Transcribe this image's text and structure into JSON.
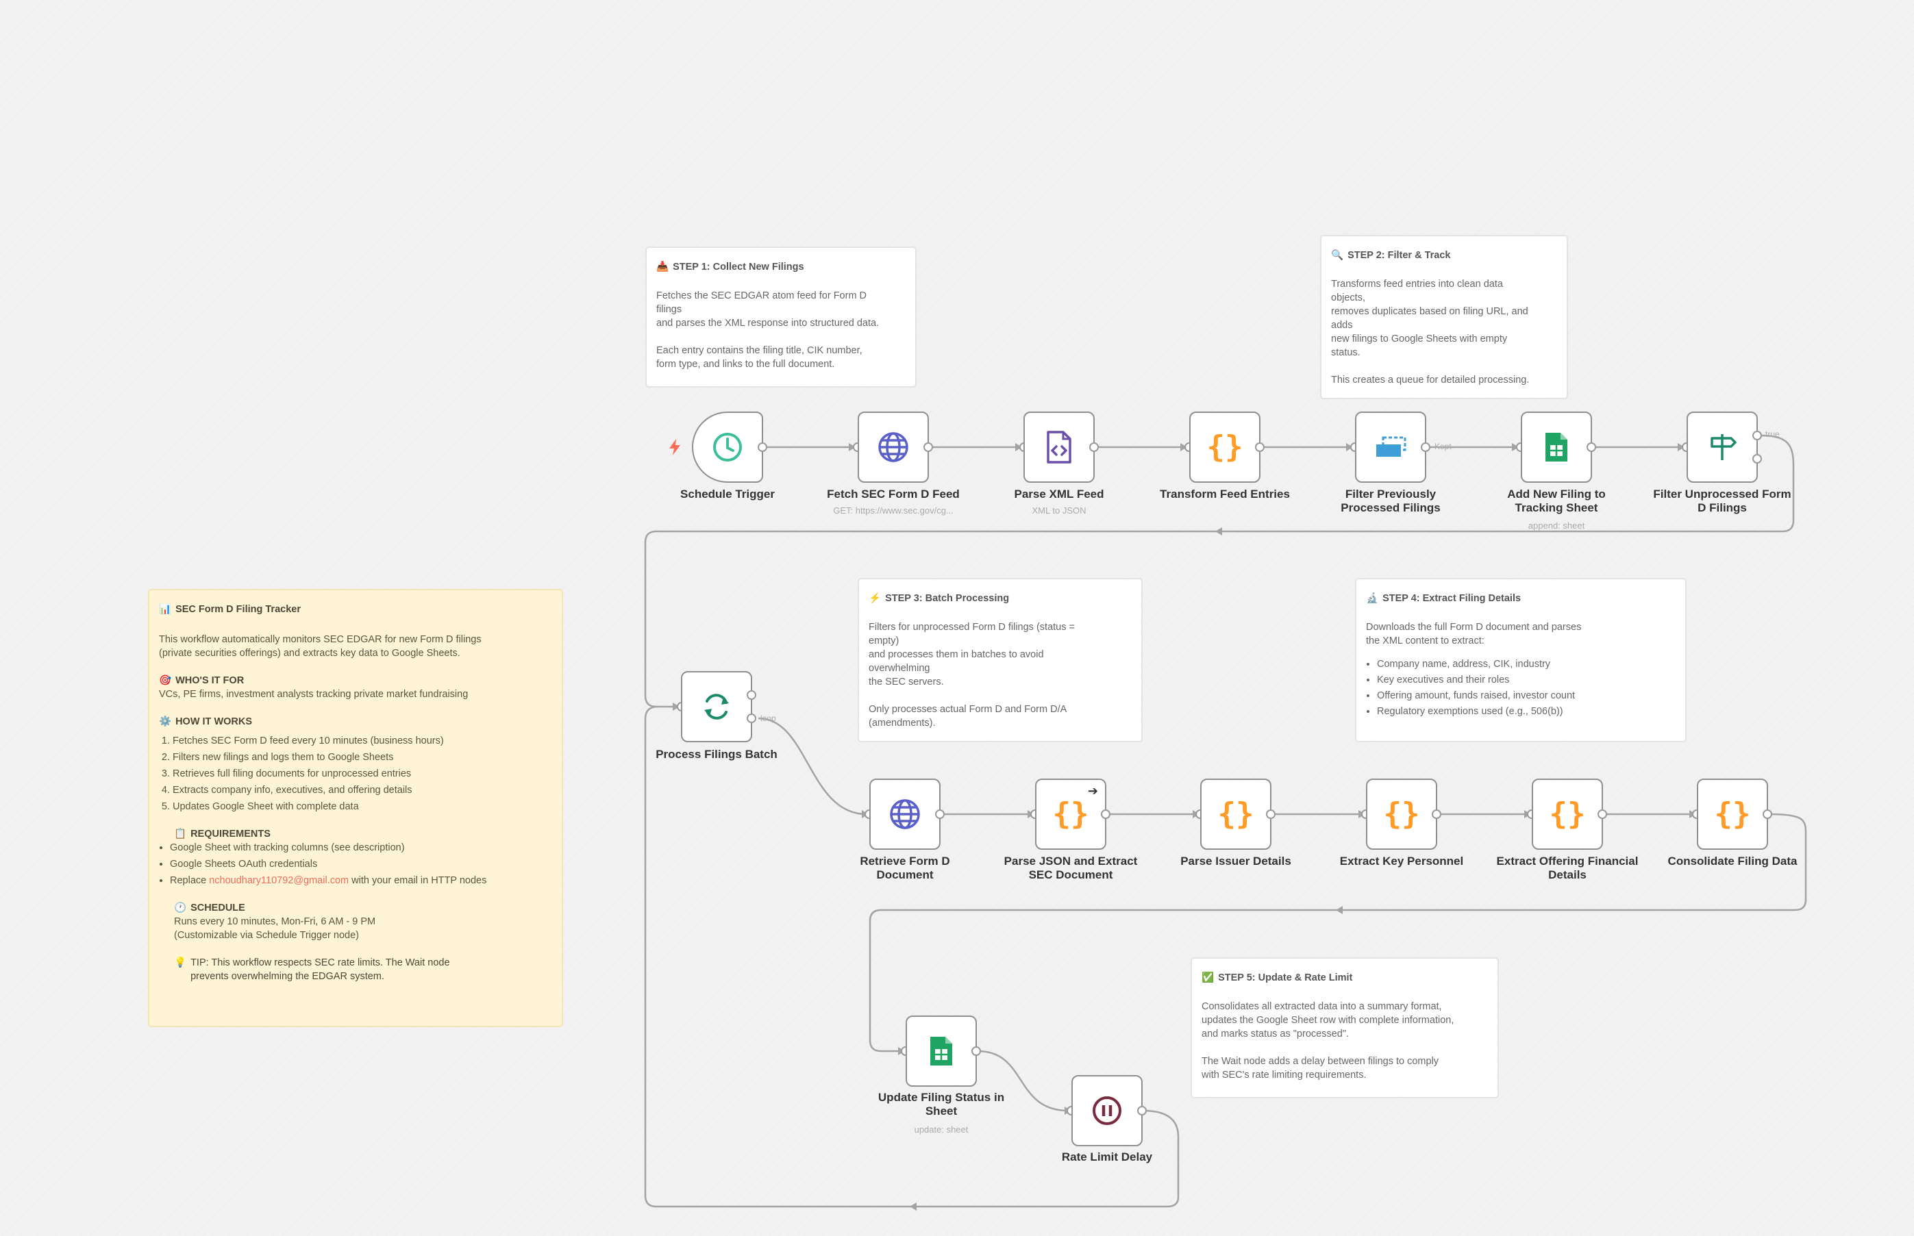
{
  "colors": {
    "accent_orange": "#ff9b26",
    "globe_blue": "#5a5fc9",
    "xml_purple": "#6b4fa8",
    "sheets_green": "#1fa463",
    "filter_blue": "#3d9ed8",
    "clock_teal": "#3bbf9a",
    "pause_maroon": "#7a2a3f",
    "trigger_red": "#ff6d5a",
    "sticky_yellow": "#fff5d6"
  },
  "overview": {
    "title": "SEC Form D Filing Tracker",
    "title_icon": "bar-chart-emoji",
    "intro": "This workflow automatically monitors SEC EDGAR for new Form D filings\n(private securities offerings) and extracts key data to Google Sheets.",
    "who_heading": "WHO'S IT FOR",
    "who_icon": "target-emoji",
    "who_text": "VCs, PE firms, investment analysts tracking private market fundraising",
    "how_heading": "HOW IT WORKS",
    "how_icon": "gear-emoji",
    "how_steps": [
      "Fetches SEC Form D feed every 10 minutes (business hours)",
      "Filters new filings and logs them to Google Sheets",
      "Retrieves full filing documents for unprocessed entries",
      "Extracts company info, executives, and offering details",
      "Updates Google Sheet with complete data"
    ],
    "req_heading": "REQUIREMENTS",
    "req_icon": "clipboard-emoji",
    "req_1": "Google Sheet with tracking columns (see description)",
    "req_2": "Google Sheets OAuth credentials",
    "req_3_prefix": "Replace ",
    "req_3_email": "nchoudhary110792@gmail.com",
    "req_3_suffix": " with your email in HTTP nodes",
    "schedule_heading": "SCHEDULE",
    "schedule_icon": "clock-emoji",
    "schedule_text": "Runs every 10 minutes, Mon-Fri, 6 AM - 9 PM\n(Customizable via Schedule Trigger node)",
    "tip_icon": "lightbulb-emoji",
    "tip_text": "TIP: This workflow respects SEC rate limits. The Wait node\nprevents overwhelming the EDGAR system."
  },
  "steps": [
    {
      "title": "STEP 1: Collect New Filings",
      "icon": "inbox-emoji",
      "body": "Fetches the SEC EDGAR atom feed for Form D\nfilings\nand parses the XML response into structured data.\n\nEach entry contains the filing title, CIK number,\nform type, and links to the full document."
    },
    {
      "title": "STEP 2: Filter & Track",
      "icon": "magnifier-emoji",
      "body": "Transforms feed entries into clean data\nobjects,\nremoves duplicates based on filing URL, and\nadds\nnew filings to Google Sheets with empty\nstatus.\n\nThis creates a queue for detailed processing."
    },
    {
      "title": "STEP 3: Batch Processing",
      "icon": "lightning-emoji",
      "body": "Filters for unprocessed Form D filings (status =\nempty)\nand processes them in batches to avoid\noverwhelming\nthe SEC servers.\n\nOnly processes actual Form D and Form D/A\n(amendments)."
    },
    {
      "title": "STEP 4: Extract Filing Details",
      "icon": "microscope-emoji",
      "intro": "Downloads the full Form D document and parses\nthe XML content to extract:",
      "bullets": [
        "Company name, address, CIK, industry",
        "Key executives and their roles",
        "Offering amount, funds raised, investor count",
        "Regulatory exemptions used (e.g., 506(b))"
      ]
    },
    {
      "title": "STEP 5: Update & Rate Limit",
      "icon": "check-mark-emoji",
      "body": "Consolidates all extracted data into a summary format,\nupdates the Google Sheet row with complete information,\nand marks status as \"processed\".\n\nThe Wait node adds a delay between filings to comply\nwith SEC's rate limiting requirements."
    }
  ],
  "nodes": [
    {
      "label": "Schedule Trigger",
      "sub": "",
      "icon": "clock-icon"
    },
    {
      "label": "Fetch SEC Form D Feed",
      "sub": "GET: https://www.sec.gov/cg...",
      "icon": "globe-icon"
    },
    {
      "label": "Parse XML Feed",
      "sub": "XML to JSON",
      "icon": "xml-file-icon"
    },
    {
      "label": "Transform Feed Entries",
      "sub": "",
      "icon": "code-braces-icon"
    },
    {
      "label": "Filter Previously\nProcessed Filings",
      "sub": "",
      "icon": "dedupe-icon"
    },
    {
      "label": "Add New Filing to\nTracking Sheet",
      "sub": "append: sheet",
      "icon": "google-sheets-icon"
    },
    {
      "label": "Filter Unprocessed Form\nD Filings",
      "sub": "",
      "icon": "signpost-icon"
    },
    {
      "label": "Process Filings Batch",
      "sub": "",
      "icon": "loop-arrows-icon"
    },
    {
      "label": "Retrieve Form D\nDocument",
      "sub": "",
      "icon": "globe-icon"
    },
    {
      "label": "Parse JSON and Extract\nSEC Document",
      "sub": "",
      "icon": "code-braces-icon"
    },
    {
      "label": "Parse Issuer Details",
      "sub": "",
      "icon": "code-braces-icon"
    },
    {
      "label": "Extract Key Personnel",
      "sub": "",
      "icon": "code-braces-icon"
    },
    {
      "label": "Extract Offering Financial\nDetails",
      "sub": "",
      "icon": "code-braces-icon"
    },
    {
      "label": "Consolidate Filing Data",
      "sub": "",
      "icon": "code-braces-icon"
    },
    {
      "label": "Update Filing Status in\nSheet",
      "sub": "update: sheet",
      "icon": "google-sheets-icon"
    },
    {
      "label": "Rate Limit Delay",
      "sub": "",
      "icon": "pause-icon"
    }
  ],
  "edge_labels": {
    "kept": "Kept",
    "true": "true",
    "loop": "loop"
  }
}
